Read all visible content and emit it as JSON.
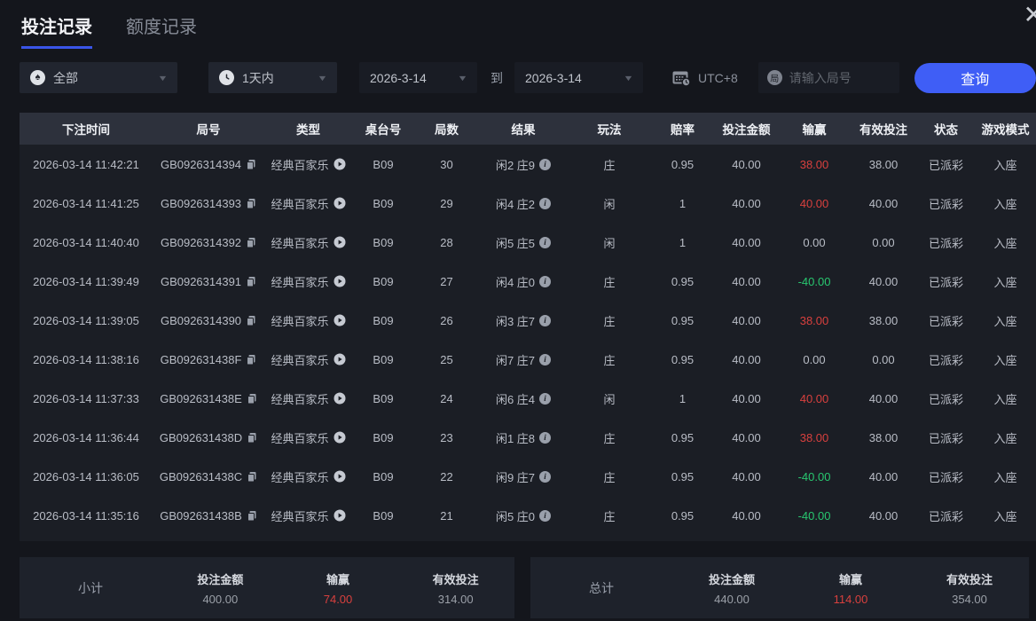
{
  "window": {
    "close_glyph": "✕"
  },
  "tabs": {
    "bet_records": "投注记录",
    "quota_records": "额度记录"
  },
  "filters": {
    "game_type": {
      "value": "全部",
      "icon_glyph": "♠"
    },
    "time_range": {
      "value": "1天内"
    },
    "date_from": "2026-3-14",
    "to_label": "到",
    "date_to": "2026-3-14",
    "timezone": "UTC+8",
    "round_icon_char": "局",
    "round_placeholder": "请输入局号",
    "query_button": "查询"
  },
  "table": {
    "columns": [
      "下注时间",
      "局号",
      "类型",
      "桌台号",
      "局数",
      "结果",
      "玩法",
      "赔率",
      "投注金额",
      "输赢",
      "有效投注",
      "状态",
      "游戏模式"
    ],
    "rows": [
      {
        "time": "2026-03-14 11:42:21",
        "round_id": "GB0926314394",
        "game_type": "经典百家乐",
        "table_no": "B09",
        "rounds": "30",
        "result": "闲2 庄9",
        "play": "庄",
        "odds": "0.95",
        "bet_amount": "40.00",
        "win_loss": "38.00",
        "win_tone": "red",
        "valid_bet": "38.00",
        "status": "已派彩",
        "mode": "入座"
      },
      {
        "time": "2026-03-14 11:41:25",
        "round_id": "GB0926314393",
        "game_type": "经典百家乐",
        "table_no": "B09",
        "rounds": "29",
        "result": "闲4 庄2",
        "play": "闲",
        "odds": "1",
        "bet_amount": "40.00",
        "win_loss": "40.00",
        "win_tone": "red",
        "valid_bet": "40.00",
        "status": "已派彩",
        "mode": "入座"
      },
      {
        "time": "2026-03-14 11:40:40",
        "round_id": "GB0926314392",
        "game_type": "经典百家乐",
        "table_no": "B09",
        "rounds": "28",
        "result": "闲5 庄5",
        "play": "闲",
        "odds": "1",
        "bet_amount": "40.00",
        "win_loss": "0.00",
        "win_tone": "neutral",
        "valid_bet": "0.00",
        "status": "已派彩",
        "mode": "入座"
      },
      {
        "time": "2026-03-14 11:39:49",
        "round_id": "GB0926314391",
        "game_type": "经典百家乐",
        "table_no": "B09",
        "rounds": "27",
        "result": "闲4 庄0",
        "play": "庄",
        "odds": "0.95",
        "bet_amount": "40.00",
        "win_loss": "-40.00",
        "win_tone": "green",
        "valid_bet": "40.00",
        "status": "已派彩",
        "mode": "入座"
      },
      {
        "time": "2026-03-14 11:39:05",
        "round_id": "GB0926314390",
        "game_type": "经典百家乐",
        "table_no": "B09",
        "rounds": "26",
        "result": "闲3 庄7",
        "play": "庄",
        "odds": "0.95",
        "bet_amount": "40.00",
        "win_loss": "38.00",
        "win_tone": "red",
        "valid_bet": "38.00",
        "status": "已派彩",
        "mode": "入座"
      },
      {
        "time": "2026-03-14 11:38:16",
        "round_id": "GB092631438F",
        "game_type": "经典百家乐",
        "table_no": "B09",
        "rounds": "25",
        "result": "闲7 庄7",
        "play": "庄",
        "odds": "0.95",
        "bet_amount": "40.00",
        "win_loss": "0.00",
        "win_tone": "neutral",
        "valid_bet": "0.00",
        "status": "已派彩",
        "mode": "入座"
      },
      {
        "time": "2026-03-14 11:37:33",
        "round_id": "GB092631438E",
        "game_type": "经典百家乐",
        "table_no": "B09",
        "rounds": "24",
        "result": "闲6 庄4",
        "play": "闲",
        "odds": "1",
        "bet_amount": "40.00",
        "win_loss": "40.00",
        "win_tone": "red",
        "valid_bet": "40.00",
        "status": "已派彩",
        "mode": "入座"
      },
      {
        "time": "2026-03-14 11:36:44",
        "round_id": "GB092631438D",
        "game_type": "经典百家乐",
        "table_no": "B09",
        "rounds": "23",
        "result": "闲1 庄8",
        "play": "庄",
        "odds": "0.95",
        "bet_amount": "40.00",
        "win_loss": "38.00",
        "win_tone": "red",
        "valid_bet": "38.00",
        "status": "已派彩",
        "mode": "入座"
      },
      {
        "time": "2026-03-14 11:36:05",
        "round_id": "GB092631438C",
        "game_type": "经典百家乐",
        "table_no": "B09",
        "rounds": "22",
        "result": "闲9 庄7",
        "play": "庄",
        "odds": "0.95",
        "bet_amount": "40.00",
        "win_loss": "-40.00",
        "win_tone": "green",
        "valid_bet": "40.00",
        "status": "已派彩",
        "mode": "入座"
      },
      {
        "time": "2026-03-14 11:35:16",
        "round_id": "GB092631438B",
        "game_type": "经典百家乐",
        "table_no": "B09",
        "rounds": "21",
        "result": "闲5 庄0",
        "play": "庄",
        "odds": "0.95",
        "bet_amount": "40.00",
        "win_loss": "-40.00",
        "win_tone": "green",
        "valid_bet": "40.00",
        "status": "已派彩",
        "mode": "入座"
      }
    ]
  },
  "summary": {
    "subtotal": {
      "label": "小计",
      "bet_amount_label": "投注金额",
      "bet_amount": "400.00",
      "win_loss_label": "输赢",
      "win_loss": "74.00",
      "valid_bet_label": "有效投注",
      "valid_bet": "314.00"
    },
    "total": {
      "label": "总计",
      "bet_amount_label": "投注金额",
      "bet_amount": "440.00",
      "win_loss_label": "输赢",
      "win_loss": "114.00",
      "valid_bet_label": "有效投注",
      "valid_bet": "354.00"
    }
  },
  "colors": {
    "accent_blue": "#3f5ef6",
    "win_red": "#d8403e",
    "loss_green": "#28c76f",
    "header_bg": "#2d313c",
    "row_bg": "#1b1e25",
    "page_bg": "#14161c"
  }
}
